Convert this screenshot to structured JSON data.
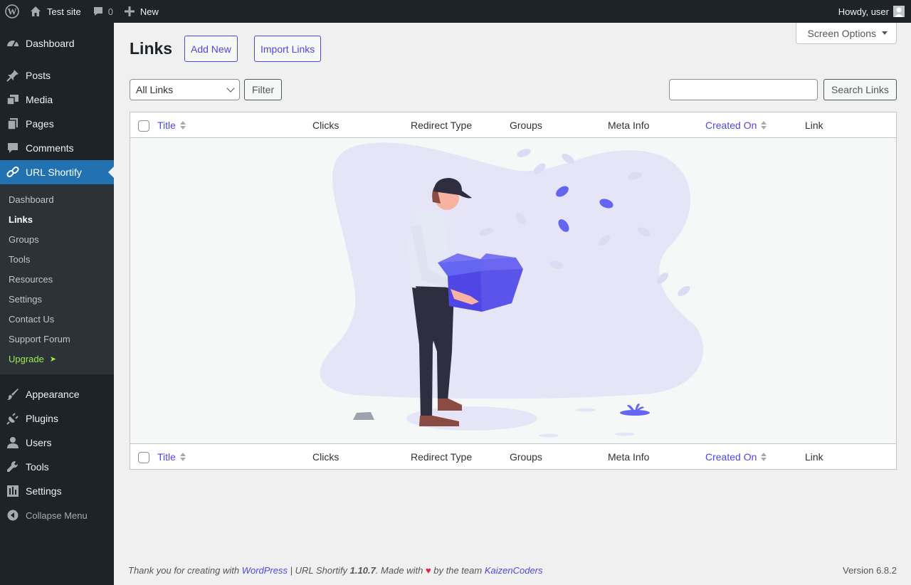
{
  "adminbar": {
    "site_name": "Test site",
    "comments_count": "0",
    "new_label": "New",
    "howdy": "Howdy, user"
  },
  "sidebar": {
    "items_top": [
      {
        "label": "Dashboard",
        "icon": "dashboard-icon"
      }
    ],
    "items_mid": [
      {
        "label": "Posts",
        "icon": "pin-icon"
      },
      {
        "label": "Media",
        "icon": "media-icon"
      },
      {
        "label": "Pages",
        "icon": "pages-icon"
      },
      {
        "label": "Comments",
        "icon": "comment-icon"
      }
    ],
    "current": {
      "label": "URL Shortify",
      "icon": "link-icon"
    },
    "submenu": [
      "Dashboard",
      "Links",
      "Groups",
      "Tools",
      "Resources",
      "Settings",
      "Contact Us",
      "Support Forum"
    ],
    "upgrade": "Upgrade",
    "upgrade_arrow": "➤",
    "items_bottom": [
      {
        "label": "Appearance",
        "icon": "brush-icon"
      },
      {
        "label": "Plugins",
        "icon": "plugin-icon"
      },
      {
        "label": "Users",
        "icon": "user-icon"
      },
      {
        "label": "Tools",
        "icon": "wrench-icon"
      },
      {
        "label": "Settings",
        "icon": "settings-icon"
      }
    ],
    "collapse": "Collapse Menu"
  },
  "screen_options": "Screen Options",
  "page": {
    "title": "Links",
    "add_new": "Add New",
    "import_links": "Import Links"
  },
  "filters": {
    "select_value": "All Links",
    "filter_button": "Filter",
    "search_button": "Search Links",
    "search_value": ""
  },
  "table": {
    "columns": {
      "title": "Title",
      "clicks": "Clicks",
      "redirect_type": "Redirect Type",
      "groups": "Groups",
      "meta_info": "Meta Info",
      "created_on": "Created On",
      "link": "Link"
    }
  },
  "footer": {
    "prefix": "Thank you for creating with",
    "wordpress": "WordPress",
    "sep": " | URL Shortify ",
    "version_plugin": "1.10.7",
    "made_with": ". Made with",
    "heart": "♥",
    "by_team": "by the team",
    "team": "KaizenCoders",
    "version": "Version 6.8.2"
  },
  "colors": {
    "accent": "#4f46e5",
    "admin_dark": "#1d2327",
    "current_menu": "#2271b1",
    "upgrade": "#9ee94b"
  }
}
